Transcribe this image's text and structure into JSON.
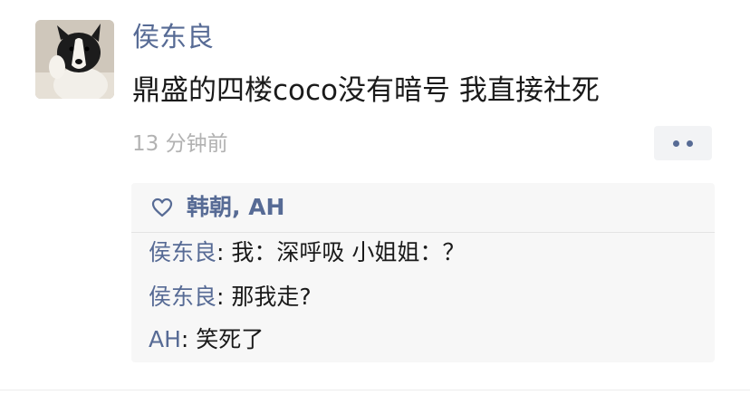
{
  "post": {
    "author": "侯东良",
    "text": "鼎盛的四楼coco没有暗号 我直接社死",
    "time": "13 分钟前"
  },
  "likes": {
    "names": "韩朝, AH"
  },
  "comments": [
    {
      "author": "侯东良",
      "separator": ": ",
      "text": "我：深呼吸 小姐姐：？"
    },
    {
      "author": "侯东良",
      "separator": ": ",
      "text": "那我走?"
    },
    {
      "author": "AH",
      "separator": ": ",
      "text": "笑死了"
    }
  ],
  "colors": {
    "name_link": "#576b95",
    "text": "#1a1a1a",
    "meta": "#b2b2b2",
    "comment_bg": "#f7f7f7"
  }
}
